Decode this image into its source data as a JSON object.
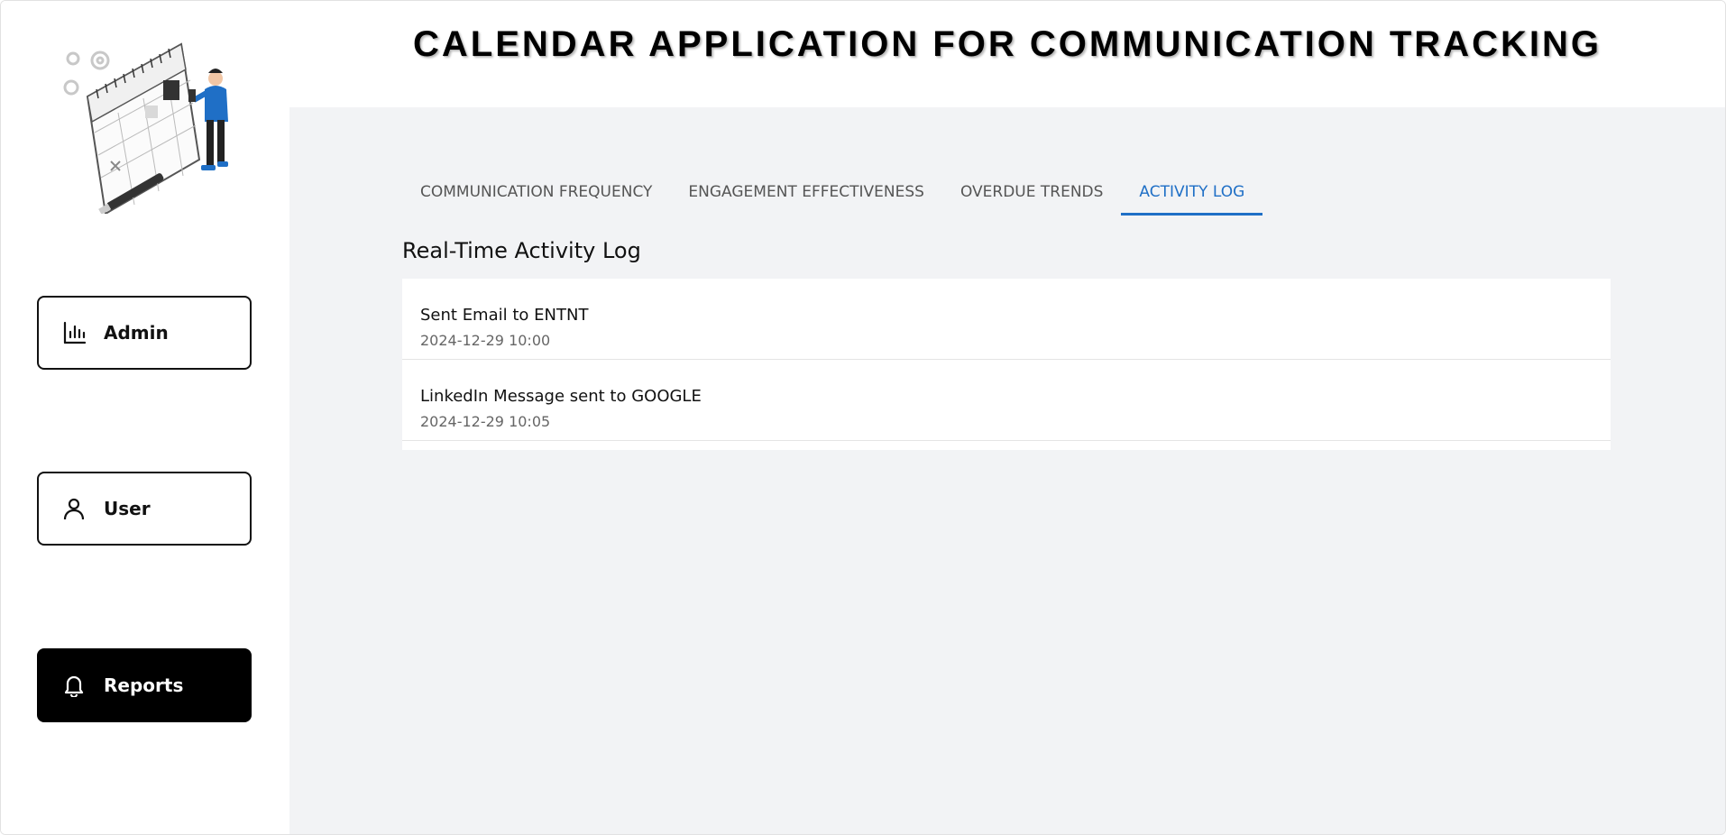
{
  "header": {
    "title": "CALENDAR APPLICATION FOR COMMUNICATION TRACKING"
  },
  "sidebar": {
    "illustration": "calendar-person-illustration",
    "items": [
      {
        "label": "Admin",
        "icon": "bar-chart-icon",
        "active": false
      },
      {
        "label": "User",
        "icon": "user-icon",
        "active": false
      },
      {
        "label": "Reports",
        "icon": "bell-icon",
        "active": true
      }
    ]
  },
  "tabs": [
    {
      "label": "COMMUNICATION FREQUENCY",
      "active": false
    },
    {
      "label": "ENGAGEMENT EFFECTIVENESS",
      "active": false
    },
    {
      "label": "OVERDUE TRENDS",
      "active": false
    },
    {
      "label": "ACTIVITY LOG",
      "active": true
    }
  ],
  "activity_log": {
    "title": "Real-Time Activity Log",
    "entries": [
      {
        "text": "Sent Email to ENTNT",
        "time": "2024-12-29 10:00"
      },
      {
        "text": "LinkedIn Message sent to GOOGLE",
        "time": "2024-12-29 10:05"
      }
    ]
  },
  "colors": {
    "accent": "#1f6fc6",
    "background": "#f2f3f5",
    "active_nav": "#000000"
  }
}
